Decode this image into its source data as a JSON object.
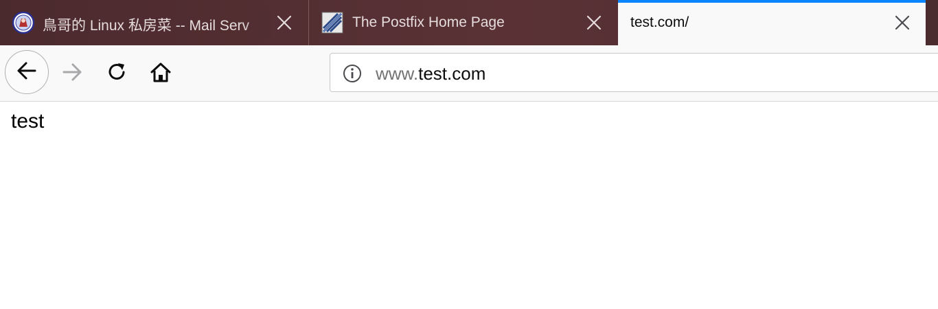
{
  "tabs": [
    {
      "title": "鳥哥的 Linux 私房菜 -- Mail Serv",
      "favicon": "vbird-logo-icon",
      "active": false
    },
    {
      "title": "The Postfix Home Page",
      "favicon": "postfix-logo-icon",
      "active": false
    },
    {
      "title": "test.com/",
      "favicon": "",
      "active": true
    }
  ],
  "toolbar": {
    "back_icon": "arrow-left-icon",
    "forward_icon": "arrow-right-icon",
    "reload_icon": "reload-icon",
    "home_icon": "home-icon"
  },
  "urlbar": {
    "info_icon": "info-icon",
    "url_prefix": "www.",
    "url_domain": "test.com"
  },
  "page": {
    "body_text": "test"
  },
  "colors": {
    "tabbar_bg": "#4b2a2d",
    "active_tab_bg": "#f9f9fa",
    "active_tab_accent": "#0a84ff",
    "toolbar_bg": "#f9f9fa"
  }
}
